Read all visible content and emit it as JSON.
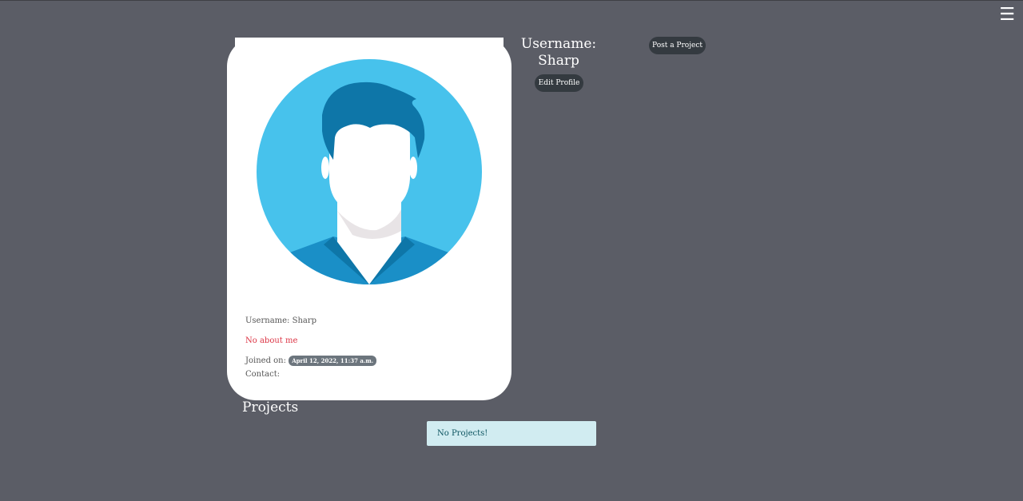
{
  "nav": {
    "menu_icon": "hamburger-icon",
    "menu_glyph": "☰"
  },
  "profile_card": {
    "avatar_icon": "default-user-avatar",
    "username_line": "Username: Sharp",
    "about": "No about me",
    "joined_label": "Joined on:",
    "joined_date": "April 12, 2022, 11:37 a.m.",
    "contact_label": "Contact:"
  },
  "sidebar": {
    "username_heading": "Username:",
    "username_value": "Sharp",
    "edit_profile_label": "Edit Profile",
    "post_project_label": "Post a Project"
  },
  "projects": {
    "title": "Projects",
    "empty_message": "No Projects!"
  },
  "colors": {
    "background": "#5b5d66",
    "card": "#ffffff",
    "avatar_circle": "#47c2ec",
    "hair": "#0e76a8",
    "button": "#343a40",
    "alert_bg": "#d1ecf1",
    "about_text": "#dc3545"
  }
}
